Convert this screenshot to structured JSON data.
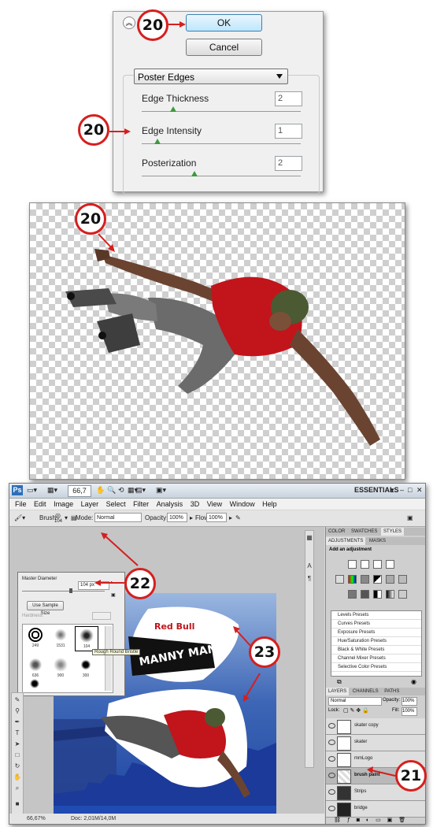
{
  "dialog": {
    "ok_label": "OK",
    "cancel_label": "Cancel",
    "filter_name": "Poster Edges",
    "params": [
      {
        "label": "Edge Thickness",
        "value": "2",
        "fraction": 0.2
      },
      {
        "label": "Edge Intensity",
        "value": "1",
        "fraction": 0.1
      },
      {
        "label": "Posterization",
        "value": "2",
        "fraction": 0.33
      }
    ]
  },
  "callouts": {
    "ok": "20",
    "intensity": "20",
    "skater": "20",
    "brush_paint": "21",
    "brush_picker": "22",
    "canvas": "23"
  },
  "photoshop": {
    "zoom": "66,7",
    "workspace": "ESSENTIALS",
    "menu": [
      "File",
      "Edit",
      "Image",
      "Layer",
      "Select",
      "Filter",
      "Analysis",
      "3D",
      "View",
      "Window",
      "Help"
    ],
    "options": {
      "brush_label": "Brush:",
      "brush_size": "104",
      "mode_label": "Mode:",
      "mode_value": "Normal",
      "opacity_label": "Opacity:",
      "opacity_value": "100%",
      "flow_label": "Flow:",
      "flow_value": "100%"
    },
    "brush_picker": {
      "master_diameter_label": "Master Diameter",
      "master_diameter_value": "104 px",
      "sample_button": "Use Sample Size",
      "hardness_label": "Hardness:",
      "tooltip": "Rough Round Bristle",
      "brushes": [
        "249",
        "1531",
        "104",
        "636",
        "900",
        "300"
      ]
    },
    "canvas": {
      "logo_brand": "Red Bull",
      "logo_text": "MANNY MANIA"
    },
    "status": {
      "zoom": "66,67%",
      "doc": "Doc: 2,01M/14,0M"
    },
    "adjustments": {
      "tabs": [
        "COLOR",
        "SWATCHES",
        "STYLES"
      ],
      "tabs2": [
        "ADJUSTMENTS",
        "MASKS"
      ],
      "title": "Add an adjustment",
      "presets": [
        "Levels Presets",
        "Curves Presets",
        "Exposure Presets",
        "Hue/Saturation Presets",
        "Black & White Presets",
        "Channel Mixer Presets",
        "Selective Color Presets"
      ]
    },
    "layers": {
      "tabs": [
        "LAYERS",
        "CHANNELS",
        "PATHS"
      ],
      "blend": "Normal",
      "opacity_label": "Opacity:",
      "opacity_value": "100%",
      "lock_label": "Lock:",
      "fill_label": "Fill:",
      "fill_value": "100%",
      "items": [
        {
          "name": "skater copy",
          "selected": false
        },
        {
          "name": "skater",
          "selected": false
        },
        {
          "name": "mmLogo",
          "selected": false
        },
        {
          "name": "brush paint",
          "selected": true
        },
        {
          "name": "Strips",
          "selected": false
        },
        {
          "name": "bridge",
          "selected": false
        }
      ]
    }
  },
  "colors": {
    "callout_red": "#d51f1f",
    "skater_shirt": "#c2141b",
    "canvas_blue": "#1a3f9c"
  }
}
